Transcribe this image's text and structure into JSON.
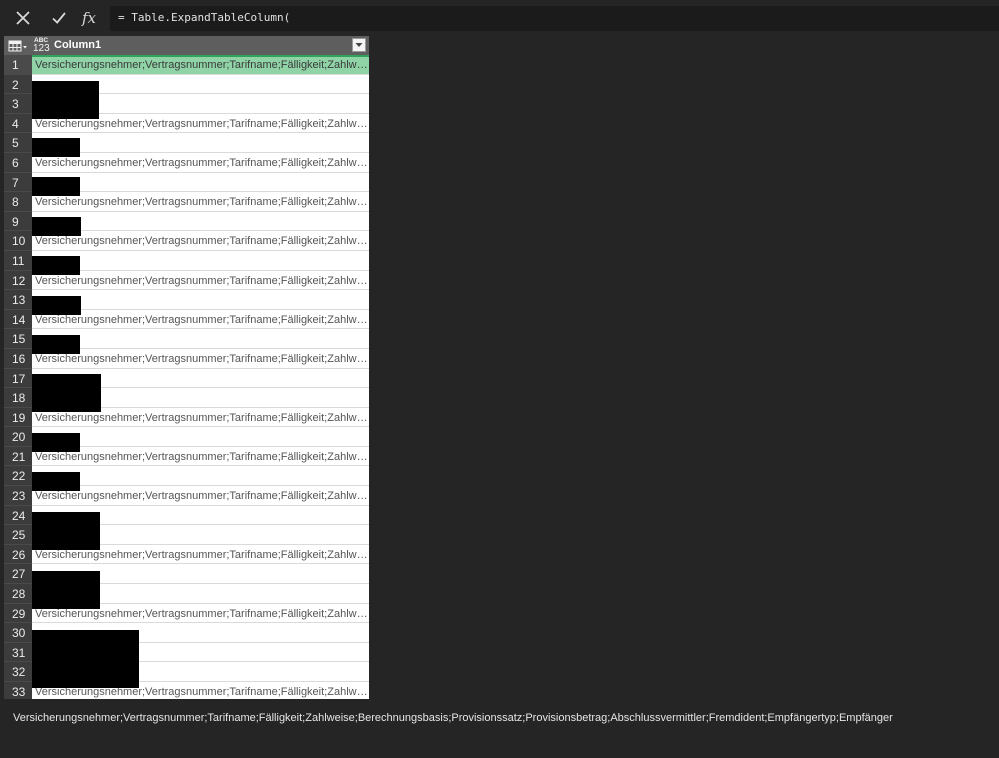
{
  "formula_bar": {
    "cancel_icon": "close-x-icon",
    "commit_icon": "checkmark-icon",
    "fx_label": "fx",
    "formula": "= Table.ExpandTableColumn("
  },
  "grid": {
    "table_menu_icon": "table-grid-icon",
    "column": {
      "type_top": "ABC",
      "type_bottom": "123",
      "name": "Column1"
    },
    "header_row_text": "Versicherungsnehmer;Vertragsnummer;Tarifname;Fälligkeit;Zahlweise;Berechnungsbasis;Provisionssatz;Provisionsbetrag;Abschlussvermittler;Fremdident;Empfängertyp;Empfänger",
    "visible_text_rows": [
      "1",
      "4",
      "6",
      "8",
      "10",
      "12",
      "14",
      "16",
      "19",
      "21",
      "23",
      "26",
      "29",
      "33"
    ],
    "selected_row": "1",
    "row_numbers": [
      "1",
      "2",
      "3",
      "4",
      "5",
      "6",
      "7",
      "8",
      "9",
      "10",
      "11",
      "12",
      "13",
      "14",
      "15",
      "16",
      "17",
      "18",
      "19",
      "20",
      "21",
      "22",
      "23",
      "24",
      "25",
      "26",
      "27",
      "28",
      "29",
      "30",
      "31",
      "32",
      "33"
    ]
  },
  "preview": {
    "text": "Versicherungsnehmer;Vertragsnummer;Tarifname;Fälligkeit;Zahlweise;Berechnungsbasis;Provisionssatz;Provisionsbetrag;Abschlussvermittler;Fremdident;Empfängertyp;Empfänger"
  }
}
